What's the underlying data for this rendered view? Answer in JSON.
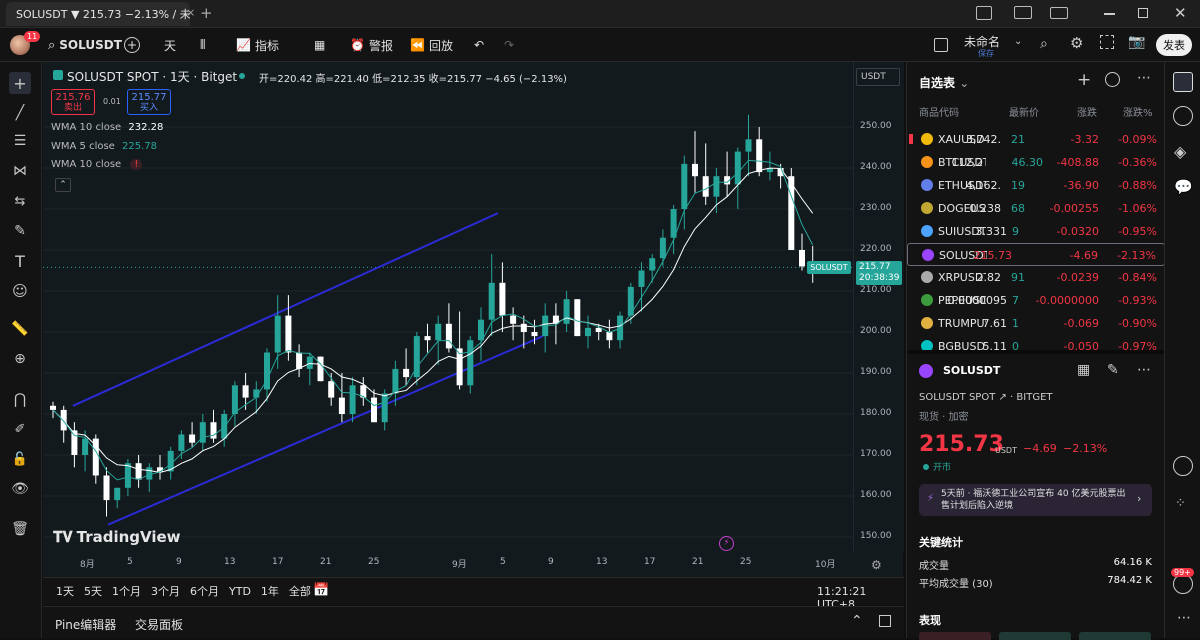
{
  "titlebar": {
    "tab_title": "SOLUSDT ▼ 215.73 −2.13% / 未命",
    "new_tab": "+"
  },
  "toolbar": {
    "avatar_badge": "11",
    "symbol": "SOLUSDT",
    "interval": "天",
    "indicators_label": "指标",
    "alerts_label": "警报",
    "replay_label": "回放",
    "layout_name": "未命名",
    "layout_sub": "保存",
    "publish_label": "发表"
  },
  "legend": {
    "title": "SOLUSDT SPOT · 1天 · Bitget",
    "ohlc": "开=220.42 高=221.40 低=212.35 收=215.77 −4.65 (−2.13%)",
    "sell_price": "215.76",
    "sell_label": "卖出",
    "spread": "0.01",
    "buy_price": "215.77",
    "buy_label": "买入",
    "indicators": [
      {
        "name": "WMA 10 close",
        "value": "232.28",
        "color": "#ffffff"
      },
      {
        "name": "WMA 5 close",
        "value": "225.78",
        "color": "#26a69a"
      },
      {
        "name": "WMA 10 close",
        "value": "!",
        "color": "#f23645"
      }
    ]
  },
  "chart": {
    "currency": "USDT",
    "watermark": "TradingView",
    "last_price_label": "SOLUSDT",
    "last_price": "215.77",
    "countdown": "20:38:39",
    "y_ticks": [
      "250.00",
      "240.00",
      "230.00",
      "220.00",
      "210.00",
      "200.00",
      "190.00",
      "180.00",
      "170.00",
      "160.00",
      "150.00"
    ],
    "x_ticks": [
      "8月",
      "5",
      "9",
      "13",
      "17",
      "21",
      "25",
      "9月",
      "5",
      "9",
      "13",
      "17",
      "21",
      "25",
      "10月"
    ],
    "up_color": "#26a69a",
    "down_color": "#ffffff",
    "channel_color": "#2b2bd6"
  },
  "timebar": {
    "ranges": [
      "1天",
      "5天",
      "1个月",
      "3个月",
      "6个月",
      "YTD",
      "1年",
      "全部"
    ],
    "clock": "11:21:21 UTC+8"
  },
  "bottombar": {
    "pine_editor": "Pine编辑器",
    "trading_panel": "交易面板"
  },
  "watchlist": {
    "title": "自选表",
    "columns": [
      "商品代码",
      "最新价",
      "涨跌",
      "涨跌%"
    ],
    "rows": [
      {
        "symbol": "XAUUSD",
        "price_main": "3,742.",
        "price_tail": "21",
        "change": "-3.32",
        "pct": "-0.09%",
        "icon_color": "#f0b90b",
        "active": false
      },
      {
        "symbol": "BTCUSDT",
        "price_main": "112,2",
        "price_tail": "46.30",
        "change": "-408.88",
        "pct": "-0.36%",
        "icon_color": "#f7931a",
        "active": false
      },
      {
        "symbol": "ETHUSDT",
        "price_main": "4,162.",
        "price_tail": "19",
        "change": "-36.90",
        "pct": "-0.88%",
        "icon_color": "#627eea",
        "active": false
      },
      {
        "symbol": "DOGEUSDT",
        "price_main": "0.238",
        "price_tail": "68",
        "change": "-0.00255",
        "pct": "-1.06%",
        "icon_color": "#c2a633",
        "active": false
      },
      {
        "symbol": "SUIUSDT",
        "price_main": "3.331",
        "price_tail": "9",
        "change": "-0.0320",
        "pct": "-0.95%",
        "icon_color": "#4da2ff",
        "active": false
      },
      {
        "symbol": "SOLUSDT",
        "price_main": "215.73",
        "price_tail": "",
        "change": "-4.69",
        "pct": "-2.13%",
        "icon_color": "#9945ff",
        "active": true
      },
      {
        "symbol": "XRPUSDT",
        "price_main": "2.82",
        "price_tail": "91",
        "change": "-0.0239",
        "pct": "-0.84%",
        "icon_color": "#aaaaaa",
        "active": false
      },
      {
        "symbol": "PEPEUSDT",
        "price_main": "0.0000095",
        "price_tail": "7",
        "change": "-0.0000000",
        "pct": "-0.93%",
        "icon_color": "#3c9b3c",
        "active": false
      },
      {
        "symbol": "TRUMPUSDT",
        "price_main": "7.61",
        "price_tail": "1",
        "change": "-0.069",
        "pct": "-0.90%",
        "icon_color": "#e0b040",
        "active": false
      },
      {
        "symbol": "BGBUSDT",
        "price_main": "5.11",
        "price_tail": "0",
        "change": "-0.050",
        "pct": "-0.97%",
        "icon_color": "#00c2c2",
        "active": false
      }
    ]
  },
  "details": {
    "symbol": "SOLUSDT",
    "exchange_line": "SOLUSDT SPOT ↗ · BITGET",
    "category": "现货 · 加密",
    "price": "215.73",
    "currency": "USDT",
    "change": "−4.69",
    "pct": "−2.13%",
    "market_status": "开市",
    "news": "5天前 · 福沃德工业公司宣布 40 亿美元股票出售计划后陷入逆境",
    "stats_title": "关键统计",
    "volume_label": "成交量",
    "volume_value": "64.16 K",
    "avg_volume_label": "平均成交量 (30)",
    "avg_volume_value": "784.42 K",
    "performance_title": "表现"
  },
  "rightrail": {
    "badge": "99+"
  }
}
